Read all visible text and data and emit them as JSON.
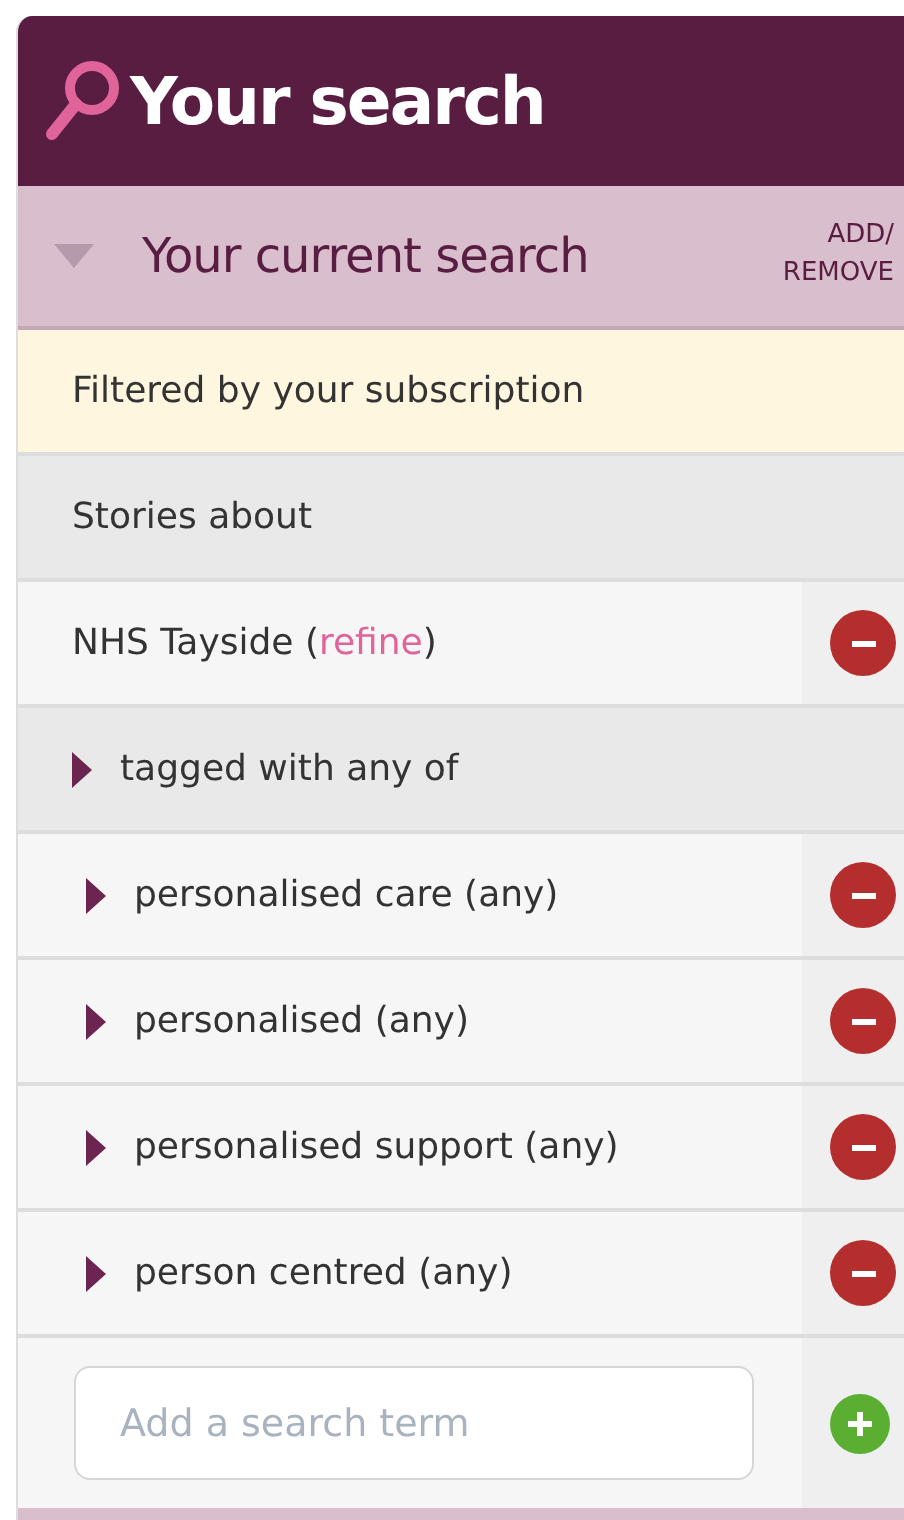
{
  "header": {
    "title": "Your search"
  },
  "current_search": {
    "title": "Your current search",
    "expanded": true,
    "action": "ADD/ REMOVE"
  },
  "subscription_note": "Filtered by your subscription",
  "stories_label": "Stories about",
  "topic": {
    "prefix": "NHS Tayside (",
    "link": "refine",
    "suffix": ")"
  },
  "tag_group": {
    "label": "tagged with any of",
    "expanded": false
  },
  "terms": [
    {
      "label": "personalised care (any)",
      "expanded": false
    },
    {
      "label": "personalised (any)",
      "expanded": false
    },
    {
      "label": "personalised support (any)",
      "expanded": false
    },
    {
      "label": "person centred (any)",
      "expanded": false
    }
  ],
  "add_term": {
    "placeholder": "Add a search term"
  }
}
